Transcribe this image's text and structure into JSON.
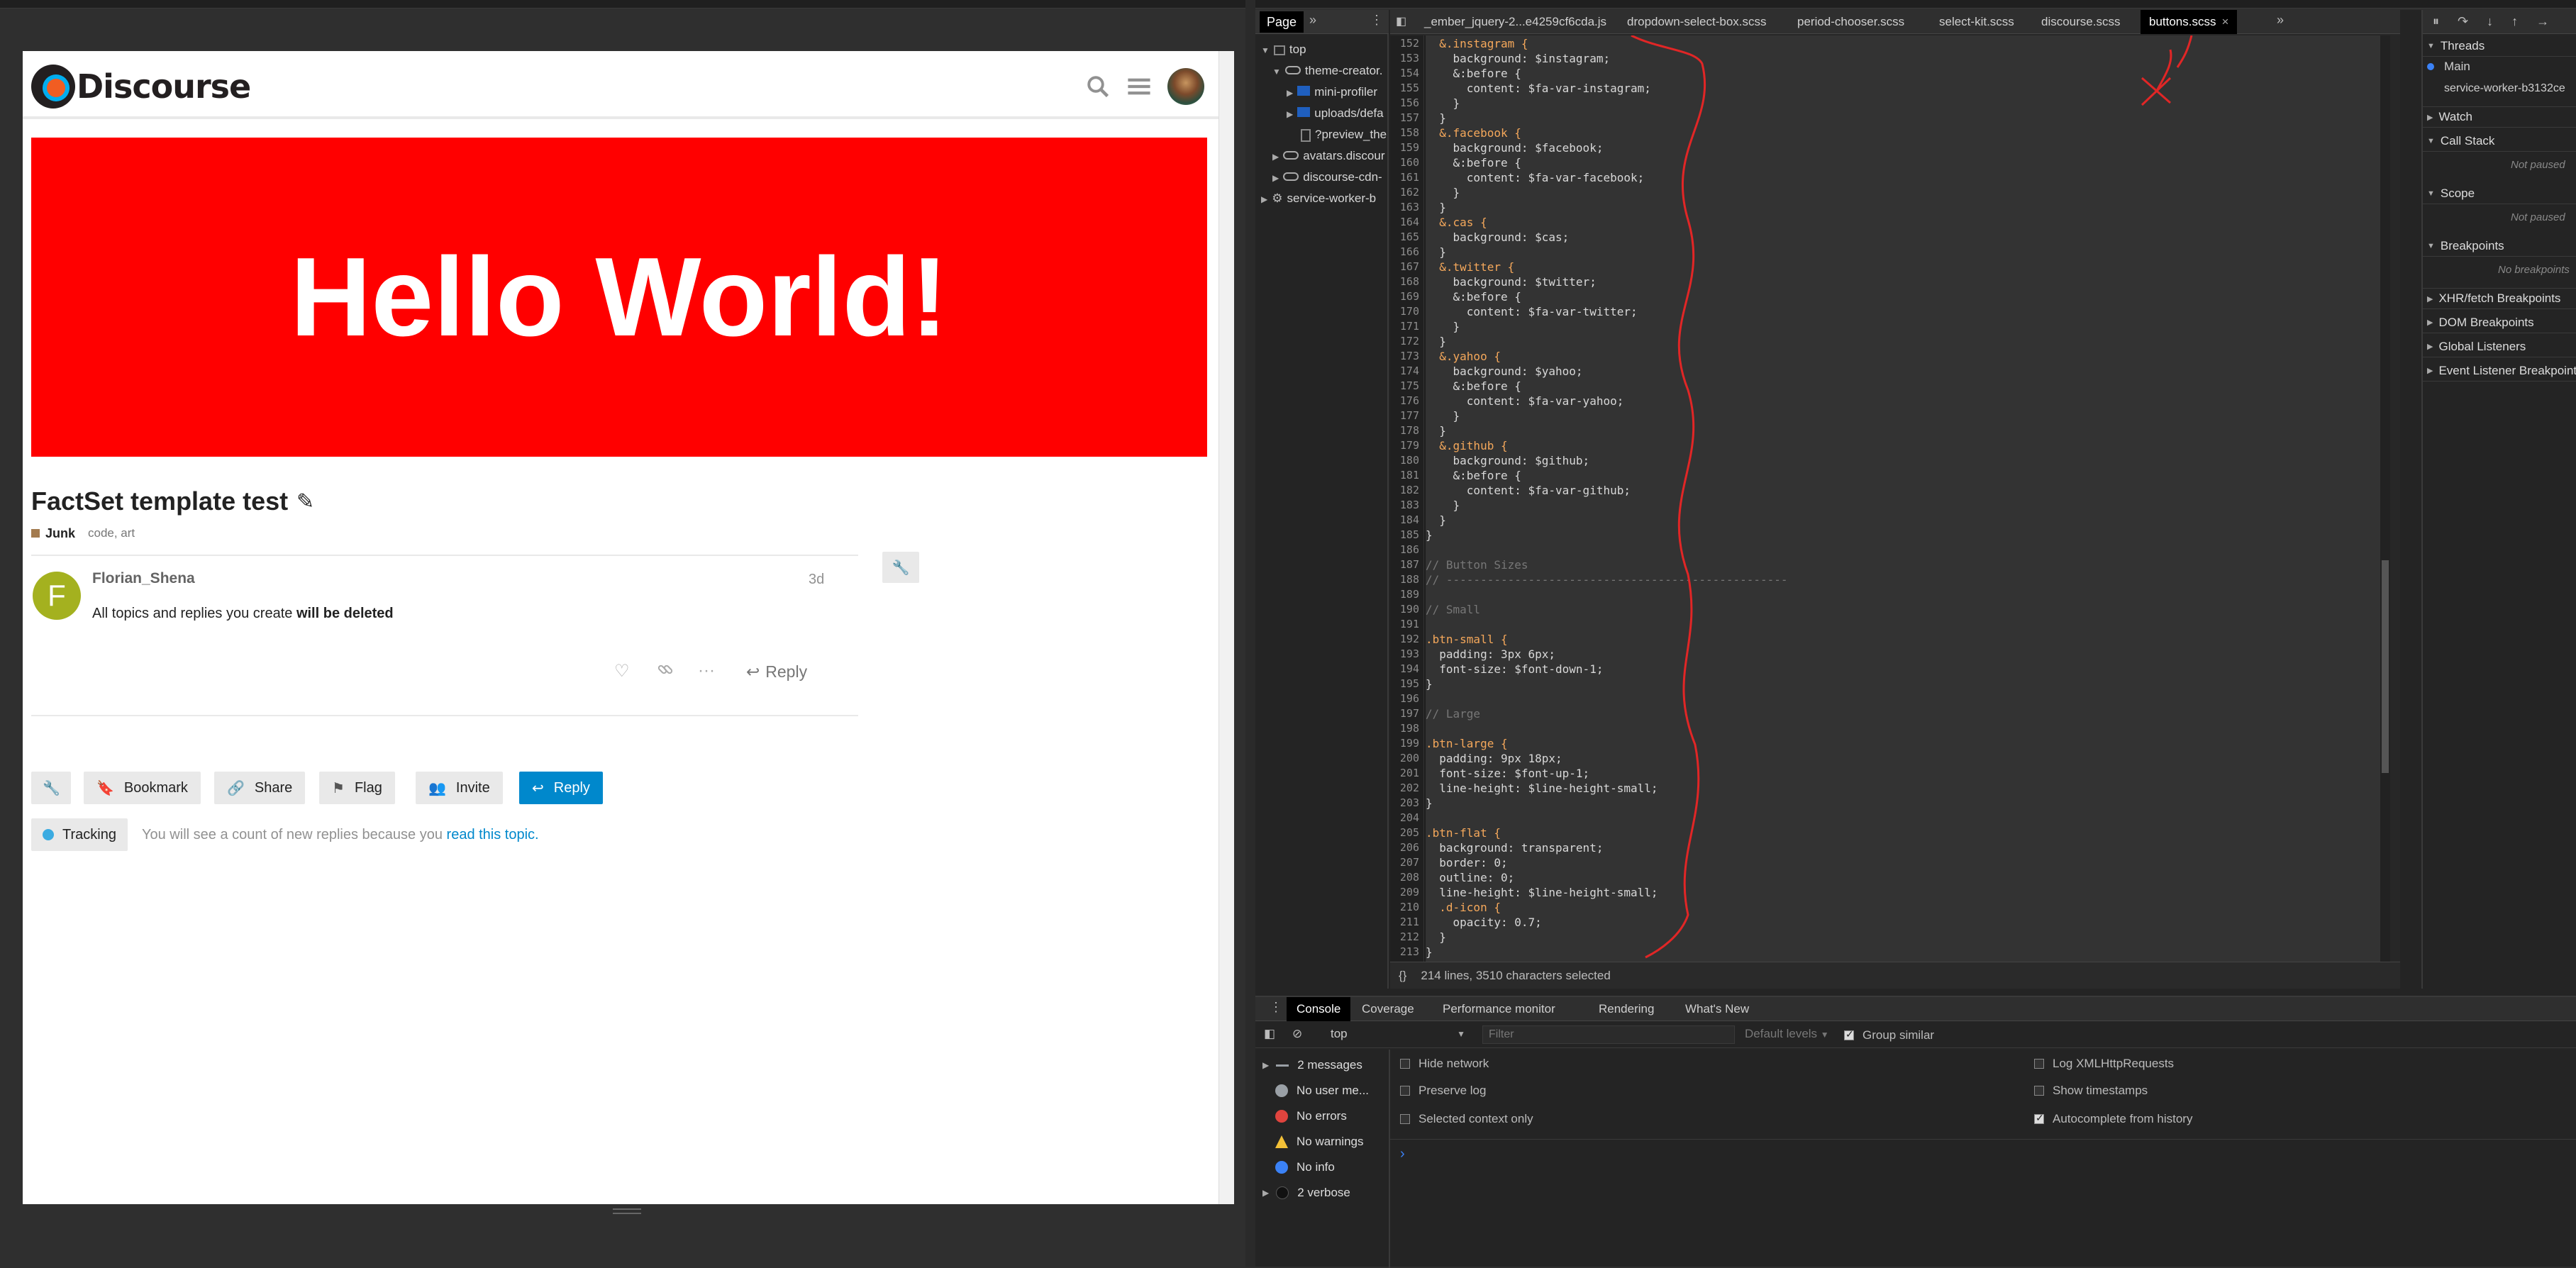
{
  "discourse": {
    "logo_text": "Discourse",
    "banner_text": "Hello World!",
    "topic_title": "FactSet template test",
    "category": "Junk",
    "tags": "code, art",
    "post": {
      "avatar_letter": "F",
      "username": "Florian_Shena",
      "date": "3d",
      "body_prefix": "All topics and replies you create ",
      "body_bold": "will be deleted",
      "reply_label": "Reply"
    },
    "footer_buttons": {
      "bookmark": "Bookmark",
      "share": "Share",
      "flag": "Flag",
      "invite": "Invite",
      "reply": "Reply"
    },
    "tracking": {
      "label": "Tracking",
      "text": "You will see a count of new replies because you ",
      "link": "read this topic."
    }
  },
  "devtools": {
    "page_tab": "Page",
    "tree": [
      {
        "label": "top",
        "type": "frame"
      },
      {
        "label": "theme-creator.",
        "type": "cloud"
      },
      {
        "label": "mini-profiler",
        "type": "folder"
      },
      {
        "label": "uploads/defa",
        "type": "folder"
      },
      {
        "label": "?preview_the",
        "type": "file"
      },
      {
        "label": "avatars.discour",
        "type": "cloud"
      },
      {
        "label": "discourse-cdn-",
        "type": "cloud"
      },
      {
        "label": "service-worker-b",
        "type": "gear"
      }
    ],
    "editor_tabs": [
      "_ember_jquery-2...e4259cf6cda.js",
      "dropdown-select-box.scss",
      "period-chooser.scss",
      "select-kit.scss",
      "discourse.scss",
      "buttons.scss"
    ],
    "active_tab": "buttons.scss",
    "code": [
      {
        "n": "152",
        "t": "  &.instagram {"
      },
      {
        "n": "153",
        "t": "    background: $instagram;"
      },
      {
        "n": "154",
        "t": "    &:before {"
      },
      {
        "n": "155",
        "t": "      content: $fa-var-instagram;"
      },
      {
        "n": "156",
        "t": "    }"
      },
      {
        "n": "157",
        "t": "  }"
      },
      {
        "n": "158",
        "t": "  &.facebook {"
      },
      {
        "n": "159",
        "t": "    background: $facebook;"
      },
      {
        "n": "160",
        "t": "    &:before {"
      },
      {
        "n": "161",
        "t": "      content: $fa-var-facebook;"
      },
      {
        "n": "162",
        "t": "    }"
      },
      {
        "n": "163",
        "t": "  }"
      },
      {
        "n": "164",
        "t": "  &.cas {"
      },
      {
        "n": "165",
        "t": "    background: $cas;"
      },
      {
        "n": "166",
        "t": "  }"
      },
      {
        "n": "167",
        "t": "  &.twitter {"
      },
      {
        "n": "168",
        "t": "    background: $twitter;"
      },
      {
        "n": "169",
        "t": "    &:before {"
      },
      {
        "n": "170",
        "t": "      content: $fa-var-twitter;"
      },
      {
        "n": "171",
        "t": "    }"
      },
      {
        "n": "172",
        "t": "  }"
      },
      {
        "n": "173",
        "t": "  &.yahoo {"
      },
      {
        "n": "174",
        "t": "    background: $yahoo;"
      },
      {
        "n": "175",
        "t": "    &:before {"
      },
      {
        "n": "176",
        "t": "      content: $fa-var-yahoo;"
      },
      {
        "n": "177",
        "t": "    }"
      },
      {
        "n": "178",
        "t": "  }"
      },
      {
        "n": "179",
        "t": "  &.github {"
      },
      {
        "n": "180",
        "t": "    background: $github;"
      },
      {
        "n": "181",
        "t": "    &:before {"
      },
      {
        "n": "182",
        "t": "      content: $fa-var-github;"
      },
      {
        "n": "183",
        "t": "    }"
      },
      {
        "n": "184",
        "t": "  }"
      },
      {
        "n": "185",
        "t": "}"
      },
      {
        "n": "186",
        "t": ""
      },
      {
        "n": "187",
        "t": "// Button Sizes"
      },
      {
        "n": "188",
        "t": "// --------------------------------------------------"
      },
      {
        "n": "189",
        "t": ""
      },
      {
        "n": "190",
        "t": "// Small"
      },
      {
        "n": "191",
        "t": ""
      },
      {
        "n": "192",
        "t": ".btn-small {"
      },
      {
        "n": "193",
        "t": "  padding: 3px 6px;"
      },
      {
        "n": "194",
        "t": "  font-size: $font-down-1;"
      },
      {
        "n": "195",
        "t": "}"
      },
      {
        "n": "196",
        "t": ""
      },
      {
        "n": "197",
        "t": "// Large"
      },
      {
        "n": "198",
        "t": ""
      },
      {
        "n": "199",
        "t": ".btn-large {"
      },
      {
        "n": "200",
        "t": "  padding: 9px 18px;"
      },
      {
        "n": "201",
        "t": "  font-size: $font-up-1;"
      },
      {
        "n": "202",
        "t": "  line-height: $line-height-small;"
      },
      {
        "n": "203",
        "t": "}"
      },
      {
        "n": "204",
        "t": ""
      },
      {
        "n": "205",
        "t": ".btn-flat {"
      },
      {
        "n": "206",
        "t": "  background: transparent;"
      },
      {
        "n": "207",
        "t": "  border: 0;"
      },
      {
        "n": "208",
        "t": "  outline: 0;"
      },
      {
        "n": "209",
        "t": "  line-height: $line-height-small;"
      },
      {
        "n": "210",
        "t": "  .d-icon {"
      },
      {
        "n": "211",
        "t": "    opacity: 0.7;"
      },
      {
        "n": "212",
        "t": "  }"
      },
      {
        "n": "213",
        "t": "}"
      },
      {
        "n": "214",
        "t": ""
      }
    ],
    "status_text": "214 lines, 3510 characters selected",
    "right": {
      "threads": "Threads",
      "main": "Main",
      "service_worker": "service-worker-b3132ce",
      "watch": "Watch",
      "call_stack": "Call Stack",
      "not_paused": "Not paused",
      "scope": "Scope",
      "not_paused2": "Not paused",
      "breakpoints": "Breakpoints",
      "no_breakpoints": "No breakpoints",
      "xhr": "XHR/fetch Breakpoints",
      "dom": "DOM Breakpoints",
      "global": "Global Listeners",
      "event": "Event Listener Breakpoints"
    },
    "console_tabs": [
      "Console",
      "Coverage",
      "Performance monitor",
      "Rendering",
      "What's New"
    ],
    "context": "top",
    "filter_placeholder": "Filter",
    "levels": "Default levels",
    "group_similar": "Group similar",
    "sidebar": [
      {
        "label": "2 messages",
        "color": "#9aa0a6"
      },
      {
        "label": "No user me...",
        "color": "#9aa0a6"
      },
      {
        "label": "No errors",
        "color": "#e0443e"
      },
      {
        "label": "No warnings",
        "color": "#f2c037"
      },
      {
        "label": "No info",
        "color": "#3b82f6"
      },
      {
        "label": "2 verbose",
        "color": "#333333"
      }
    ],
    "options_left": [
      {
        "label": "Hide network",
        "checked": false
      },
      {
        "label": "Preserve log",
        "checked": false
      },
      {
        "label": "Selected context only",
        "checked": false
      }
    ],
    "options_right": [
      {
        "label": "Log XMLHttpRequests",
        "checked": false
      },
      {
        "label": "Show timestamps",
        "checked": false
      },
      {
        "label": "Autocomplete from history",
        "checked": true
      }
    ],
    "prompt": "›"
  }
}
